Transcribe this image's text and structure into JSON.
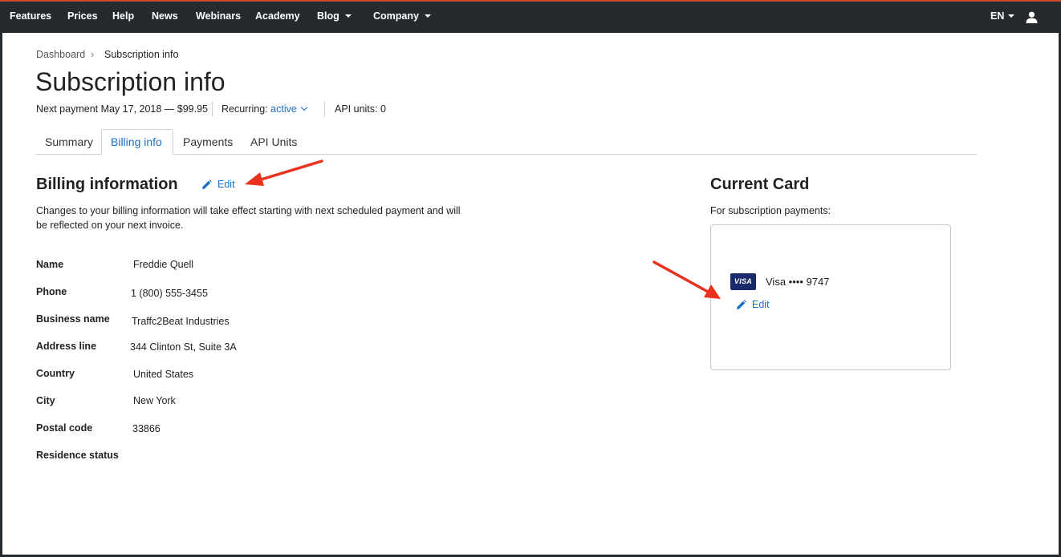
{
  "nav": {
    "items": [
      {
        "label": "Features"
      },
      {
        "label": "Prices"
      },
      {
        "label": "Help"
      },
      {
        "label": "News"
      },
      {
        "label": "Webinars"
      },
      {
        "label": "Academy"
      },
      {
        "label": "Blog"
      },
      {
        "label": "Company"
      }
    ],
    "language": "EN"
  },
  "breadcrumb": {
    "root": "Dashboard",
    "current": "Subscription info"
  },
  "page": {
    "title": "Subscription info",
    "next_payment": "Next payment May 17, 2018 — $99.95",
    "recurring_label": "Recurring:",
    "recurring_value": "active",
    "api_units": "API units: 0"
  },
  "tabs": [
    {
      "label": "Summary"
    },
    {
      "label": "Billing info"
    },
    {
      "label": "Payments"
    },
    {
      "label": "API Units"
    }
  ],
  "billing": {
    "title": "Billing information",
    "edit_label": "Edit",
    "description": "Changes to your billing information will take effect starting with next scheduled payment and will be reflected on your next invoice.",
    "fields": [
      {
        "label": "Name",
        "value": "Freddie Quell"
      },
      {
        "label": "Phone",
        "value": "1 (800) 555-3455"
      },
      {
        "label": "Business name",
        "value": "Traffc2Beat Industries"
      },
      {
        "label": "Address line",
        "value": "344 Clinton St, Suite 3A"
      },
      {
        "label": "Country",
        "value": "United States"
      },
      {
        "label": "City",
        "value": "New York"
      },
      {
        "label": "Postal code",
        "value": "33866"
      },
      {
        "label": "Residence status",
        "value": ""
      }
    ]
  },
  "card": {
    "title": "Current Card",
    "subtitle": "For subscription payments:",
    "brand_badge": "VISA",
    "description": "Visa •••• 9747",
    "edit_label": "Edit"
  },
  "colors": {
    "nav_bg": "#242a2e",
    "link": "#1b6ec2",
    "annotation_arrow": "#e8321e"
  }
}
